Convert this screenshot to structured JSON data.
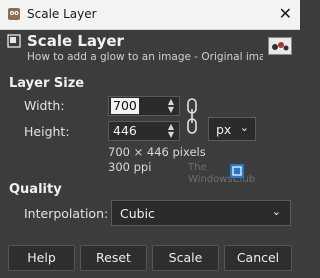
{
  "window": {
    "title": "Scale Layer",
    "close_glyph": "✕"
  },
  "header": {
    "title": "Scale Layer",
    "subtitle": "How to add a glow to an image - Original imag..."
  },
  "layer_size": {
    "section_title": "Layer Size",
    "width_label": "Width:",
    "width_value": "700",
    "height_label": "Height:",
    "height_value": "446",
    "unit": "px",
    "pixels_info": "700 × 446 pixels",
    "ppi_info": "300 ppi"
  },
  "quality": {
    "section_title": "Quality",
    "interpolation_label": "Interpolation:",
    "interpolation_value": "Cubic"
  },
  "watermark": {
    "line1": "The",
    "line2": "WindowsClub"
  },
  "buttons": {
    "help": "Help",
    "reset": "Reset",
    "scale": "Scale",
    "cancel": "Cancel"
  },
  "icons": {
    "app": "gimp-icon",
    "dialog": "scale-layer-icon",
    "chain": "chain-link-icon",
    "watermark": "windowsclub-logo-icon"
  },
  "colors": {
    "background": "#3c3c3c",
    "titlebar": "#f3f3f3",
    "selection": "#f2f2f2"
  }
}
